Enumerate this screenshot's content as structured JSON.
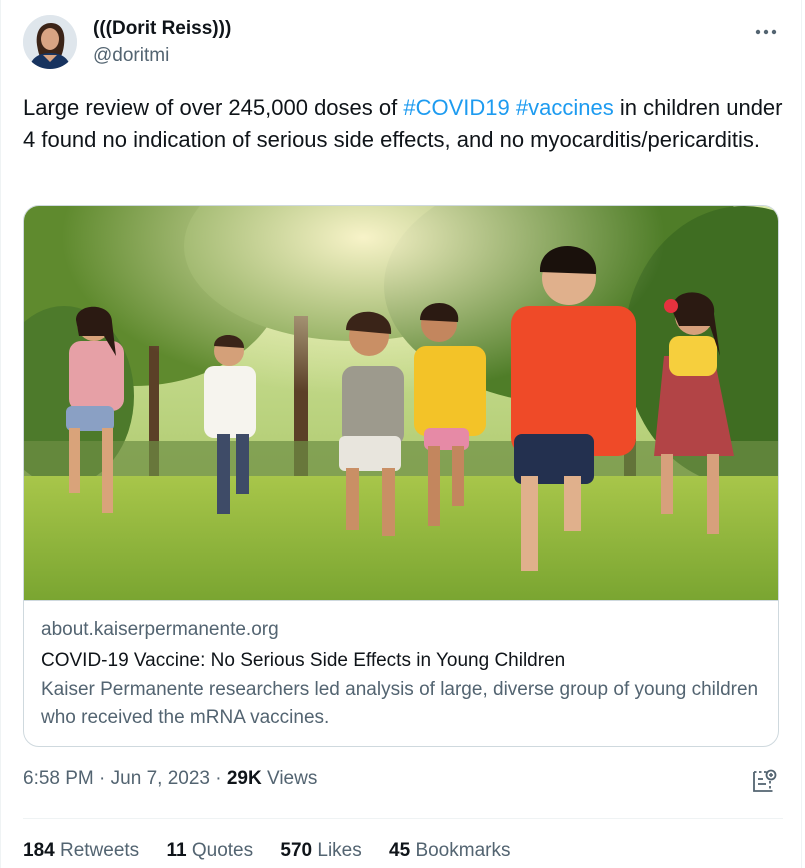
{
  "author": {
    "display_name": "(((Dorit Reiss)))",
    "handle": "@doritmi",
    "avatar_icon": "profile-photo"
  },
  "tweet": {
    "text_before": "Large review of over 245,000 doses of ",
    "hashtag1": "#COVID19",
    "space": " ",
    "hashtag2": "#vaccines",
    "text_after": " in children under 4 found no indication of serious side effects, and no myocarditis/pericarditis."
  },
  "card": {
    "image_description_icon": "children-running-in-park-photo",
    "domain": "about.kaiserpermanente.org",
    "title": "COVID-19 Vaccine: No Serious Side Effects in Young Children",
    "description": "Kaiser Permanente researchers led analysis of large, diverse group of young children who received the mRNA vaccines."
  },
  "meta": {
    "time": "6:58 PM",
    "dot1": " · ",
    "date": "Jun 7, 2023",
    "dot2": " · ",
    "views_count": "29K",
    "views_label": " Views"
  },
  "stats": {
    "retweets_count": "184",
    "retweets_label": "Retweets",
    "quotes_count": "11",
    "quotes_label": "Quotes",
    "likes_count": "570",
    "likes_label": "Likes",
    "bookmarks_count": "45",
    "bookmarks_label": "Bookmarks"
  },
  "colors": {
    "link": "#1d9bf0",
    "text_primary": "#0f1419",
    "text_secondary": "#536471",
    "border": "#cfd9de"
  }
}
